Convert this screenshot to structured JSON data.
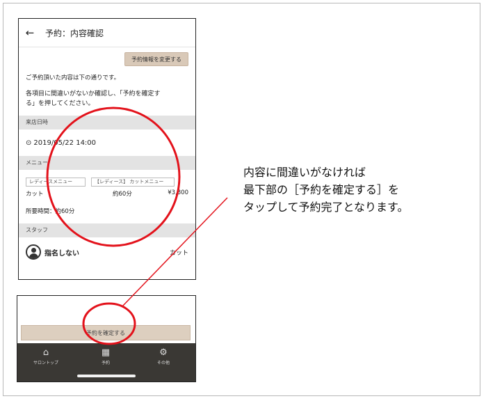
{
  "header": {
    "back_icon": "←",
    "title": "予約：内容確認"
  },
  "change_button_label": "予約情報を変更する",
  "intro": {
    "line1": "ご予約頂いた内容は下の通りです。",
    "line2a": "各項目に間違いがないか確認し、「予約を確定す",
    "line2b": "る」を押してください。"
  },
  "visit": {
    "section_label": "来店日時",
    "datetime": "2019/05/22 14:00",
    "clock_icon": "⊙"
  },
  "menu": {
    "section_label": "メニュー",
    "tags": [
      "レディースメニュー",
      "【レディース】 カットメニュー"
    ],
    "item": {
      "name": "カット",
      "duration": "約60分",
      "price": "¥3,800"
    },
    "total_duration": "所要時間：約60分"
  },
  "staff": {
    "section_label": "スタッフ",
    "name": "指名しない",
    "role": "カット"
  },
  "confirm_button_label": "予約を確定する",
  "tabbar": {
    "home": {
      "icon": "⌂",
      "label": "サロントップ"
    },
    "reservation": {
      "icon": "▦",
      "label": "予約"
    },
    "other": {
      "icon": "⚙",
      "label": "その他"
    }
  },
  "caption": {
    "line1": "内容に間違いがなければ",
    "line2": "最下部の［予約を確定する］を",
    "line3": "タップして予約完了となります。"
  },
  "colors": {
    "annotation_red": "#e3121b",
    "button_beige": "#d9c9b8",
    "tabbar_dark": "#3a3834"
  }
}
